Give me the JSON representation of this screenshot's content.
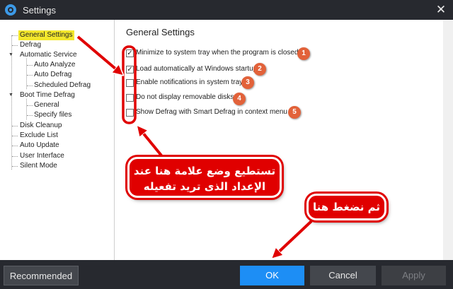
{
  "window": {
    "title": "Settings",
    "close_glyph": "✕",
    "icon": "app-logo-icon"
  },
  "tree": {
    "items": [
      {
        "key": "general_settings",
        "label": "General Settings",
        "selected": true
      },
      {
        "key": "defrag",
        "label": "Defrag"
      },
      {
        "key": "automatic_service",
        "label": "Automatic Service",
        "expanded": true
      },
      {
        "key": "auto_analyze",
        "label": "Auto Analyze"
      },
      {
        "key": "auto_defrag",
        "label": "Auto Defrag"
      },
      {
        "key": "scheduled_defrag",
        "label": "Scheduled Defrag"
      },
      {
        "key": "boot_time_defrag",
        "label": "Boot Time Defrag",
        "expanded": true
      },
      {
        "key": "general",
        "label": "General"
      },
      {
        "key": "specify_files",
        "label": "Specify files"
      },
      {
        "key": "disk_cleanup",
        "label": "Disk Cleanup"
      },
      {
        "key": "exclude_list",
        "label": "Exclude List"
      },
      {
        "key": "auto_update",
        "label": "Auto Update"
      },
      {
        "key": "user_interface",
        "label": "User Interface"
      },
      {
        "key": "silent_mode",
        "label": "Silent Mode"
      }
    ]
  },
  "panel": {
    "heading": "General Settings",
    "options": [
      {
        "label": "Minimize to system tray when the program is closed",
        "checked": true,
        "badge": "1"
      },
      {
        "label": "Load automatically at Windows startup",
        "checked": true,
        "badge": "2"
      },
      {
        "label": "Enable notifications in system tray",
        "checked": false,
        "badge": "3"
      },
      {
        "label": "Do not display removable disks",
        "checked": false,
        "badge": "4"
      },
      {
        "label": "Show Defrag with Smart Defrag in context menu",
        "checked": false,
        "badge": "5"
      }
    ]
  },
  "footer": {
    "recommended": "Recommended",
    "ok": "OK",
    "cancel": "Cancel",
    "apply": "Apply"
  },
  "annotations": {
    "callout_checkboxes_line1": "تستطيع وضع علامة هنا عند",
    "callout_checkboxes_line2": "الإعداد الذى تريد تفعيله",
    "callout_ok": "ثم نضغط هنا"
  },
  "colors": {
    "titlebar": "#27292f",
    "selection_highlight": "#f3e72c",
    "ok_button": "#1d8ef5",
    "annotation_red": "#e00000",
    "badge": "#e2623a"
  }
}
